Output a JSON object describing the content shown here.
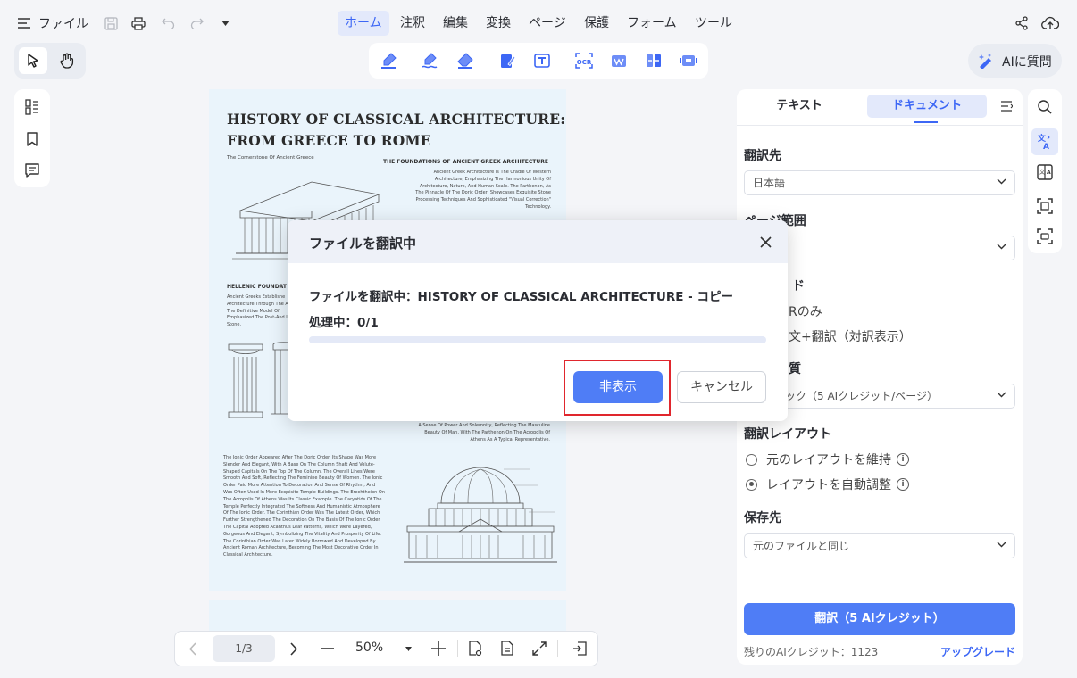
{
  "topbar": {
    "file_menu": "ファイル",
    "menus": [
      "ホーム",
      "注釈",
      "編集",
      "変換",
      "ページ",
      "保護",
      "フォーム",
      "ツール"
    ],
    "active_menu": "ホーム"
  },
  "ai_button": {
    "label": "AIに質問"
  },
  "document": {
    "title_line1": "HISTORY OF CLASSICAL  ARCHITECTURE:",
    "title_line2": "FROM GREECE TO ROME",
    "subtitle": "The Cornerstone Of Ancient Greece",
    "section1_heading": "THE FOUNDATIONS OF ANCIENT GREEK ARCHITECTURE",
    "section1_text": "Ancient Greek Architecture Is The Cradle Of Western Architecture, Emphasizing The Harmonious Unity Of Architecture, Nature, And Human Scale. The Parthenon, As The Pinnacle Of The Doric Order, Showcases Exquisite Stone Processing Techniques And Sophisticated \"Visual Correction\" Technology.",
    "section2_heading": "HELLENIC FOUNDAT",
    "section2_text": "Ancient Greeks Establishe Architecture Through The As The Definitive Model Of Emphasized The Post-And In Stone.",
    "section3_text": "A Sense Of Power And Solemnity, Reflecting The Masculine Beauty Of Man, With The Parthenon On The Acropolis Of Athens As A Typical Representative.",
    "section4_text": "The Ionic Order Appeared After The Doric Order. Its Shape Was More Slender And Elegant, With A Base On The Column Shaft And Volute-Shaped Capitals On The Top Of The Column. The Overall Lines Were Smooth And Soft, Reflecting The Feminine Beauty Of Women. The Ionic Order Paid More Attention To Decoration And Sense Of Rhythm, And Was Often Used In More Exquisite Temple Buildings. The Erechtheion On The Acropolis Of Athens Was Its Classic Example. The Caryatids Of The Temple Perfectly Integrated The Softness And Humanistic Atmosphere Of The Ionic Order. The Corinthian Order Was The Latest Order, Which Further Strengthened The Decoration On The Basis Of The Ionic Order. The Capital Adopted Acanthus Leaf Patterns, Which Were Layered, Gorgeous And Elegant, Symbolizing The Vitality And Prosperity Of Life. The Corinthian Order Was Later Widely Borrowed And Developed By Ancient Roman Architecture, Becoming The Most Decorative Order In Classical Architecture."
  },
  "dialog": {
    "title": "ファイルを翻訳中",
    "message": "ファイルを翻訳中：HISTORY OF CLASSICAL ARCHITECTURE - コピー",
    "progress_text": "処理中：0/1",
    "progress_value": 0,
    "hide_button": "非表示",
    "cancel_button": "キャンセル"
  },
  "panel": {
    "tab_text": "テキスト",
    "tab_document": "ドキュメント",
    "target_label": "翻訳先",
    "target_value": "日本語",
    "range_label": "ページ範囲",
    "mode_label": "ド",
    "mode_opt1": "Rのみ",
    "mode_opt2": "文+翻訳（対訳表示）",
    "quality_label": "質",
    "quality_value": "ック（5 AIクレジット/ページ）",
    "layout_label": "翻訳レイアウト",
    "layout_opt1": "元のレイアウトを維持",
    "layout_opt2": "レイアウトを自動調整",
    "save_label": "保存先",
    "save_value": "元のファイルと同じ",
    "translate_button": "翻訳（5 AIクレジット）",
    "credits_text": "残りのAIクレジット：1123",
    "upgrade_link": "アップグレード"
  },
  "bottombar": {
    "page_value": "1/3",
    "zoom_value": "50%"
  }
}
